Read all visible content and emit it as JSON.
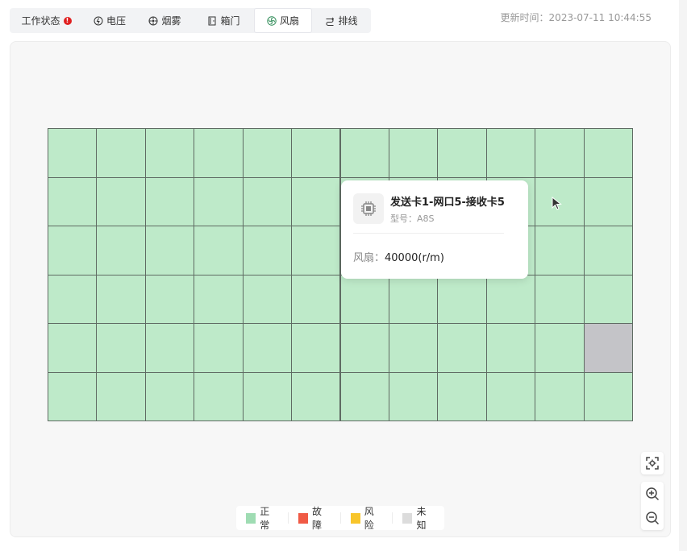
{
  "tabs": [
    {
      "label": "工作状态",
      "icon": "alert-icon",
      "badge": "!"
    },
    {
      "label": "电压",
      "icon": "voltage-icon"
    },
    {
      "label": "烟雾",
      "icon": "smoke-icon"
    },
    {
      "label": "箱门",
      "icon": "door-icon"
    },
    {
      "label": "风扇",
      "icon": "fan-icon",
      "active": true
    },
    {
      "label": "排线",
      "icon": "cable-icon"
    }
  ],
  "update_time": "更新时间：2023-07-11 10:44:55",
  "grid": {
    "rows": 6,
    "cols": 12,
    "cells": [
      [
        "normal",
        "normal",
        "normal",
        "normal",
        "normal",
        "normal",
        "normal",
        "normal",
        "normal",
        "normal",
        "normal",
        "normal"
      ],
      [
        "normal",
        "normal",
        "normal",
        "normal",
        "normal",
        "normal",
        "normal",
        "normal",
        "normal",
        "normal",
        "normal",
        "normal"
      ],
      [
        "normal",
        "normal",
        "normal",
        "normal",
        "normal",
        "normal",
        "normal",
        "normal",
        "normal",
        "normal",
        "normal",
        "normal"
      ],
      [
        "normal",
        "normal",
        "normal",
        "normal",
        "normal",
        "normal",
        "normal",
        "normal",
        "normal",
        "normal",
        "normal",
        "normal"
      ],
      [
        "normal",
        "normal",
        "normal",
        "normal",
        "normal",
        "normal",
        "normal",
        "normal",
        "normal",
        "normal",
        "normal",
        "unknown"
      ],
      [
        "normal",
        "normal",
        "normal",
        "normal",
        "normal",
        "normal",
        "normal",
        "normal",
        "normal",
        "normal",
        "normal",
        "normal"
      ]
    ]
  },
  "status_colors": {
    "normal": "#beeac9",
    "fault": "#f05a45",
    "risk": "#f8c52a",
    "unknown": "#c4c4c8"
  },
  "tooltip": {
    "title": "发送卡1-网口5-接收卡5",
    "model": "型号：A8S",
    "fan_label": "风扇：",
    "fan_value": "40000(r/m)",
    "icon": "chip-icon"
  },
  "legend": [
    {
      "label": "正常",
      "color": "#9fdcb3"
    },
    {
      "label": "故障",
      "color": "#f05a45"
    },
    {
      "label": "风险",
      "color": "#f8c52a"
    },
    {
      "label": "未知",
      "color": "#dcdcdc"
    }
  ],
  "controls": {
    "fit": "fit-view-icon",
    "zoom_in": "zoom-in-icon",
    "zoom_out": "zoom-out-icon"
  }
}
